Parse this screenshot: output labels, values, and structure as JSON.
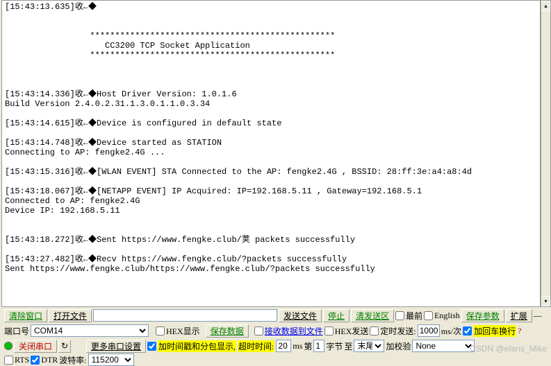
{
  "terminal": {
    "lines": [
      "[15:43:13.635]收←◆",
      "",
      "",
      "                 *************************************************",
      "                    CC3200 TCP Socket Application       ",
      "                 *************************************************",
      "",
      "",
      "",
      "[15:43:14.336]收←◆Host Driver Version: 1.0.1.6",
      "Build Version 2.4.0.2.31.1.3.0.1.1.0.3.34",
      "",
      "[15:43:14.615]收←◆Device is configured in default state ",
      "",
      "[15:43:14.748]收←◆Device started as STATION ",
      "Connecting to AP: fengke2.4G ...",
      "",
      "[15:43:15.316]收←◆[WLAN EVENT] STA Connected to the AP: fengke2.4G , BSSID: 28:ff:3e:a4:a8:4d",
      "",
      "[15:43:18.067]收←◆[NETAPP EVENT] IP Acquired: IP=192.168.5.11 , Gateway=192.168.5.1",
      "Connected to AP: fengke2.4G ",
      "Device IP: 192.168.5.11",
      "",
      "",
      "[15:43:18.272]收←◆Sent https://www.fengke.club/荚 packets successfully",
      "",
      "[15:43:27.482]收←◆Recv https://www.fengke.club/?packets successfully",
      "Sent https://www.fengke.club/https://www.fengke.club/?packets successfully"
    ]
  },
  "row1": {
    "clear_window": "清除窗口",
    "open_file": "打开文件",
    "send_file": "发送文件",
    "stop": "停止",
    "clear_send": "清发送区",
    "front": "最前",
    "english": "English",
    "save_params": "保存参数",
    "extend": "扩展",
    "dash_label": "—"
  },
  "row2": {
    "port_label": "端口号",
    "port_value": "COM14",
    "hex_display": "HEX显示",
    "save_data": "保存数据",
    "recv_to_file": "接收数据到文件",
    "hex_send": "HEX发送",
    "timed_send": "定时发送:",
    "interval_value": "1000",
    "interval_unit": "ms/次",
    "add_cr": "加回车换行",
    "question": "?"
  },
  "row3": {
    "led_status": "green",
    "close_port": "关闭串口",
    "more_settings": "更多串口设置",
    "timestamp_label": "加时间戳和分包显示,",
    "timeout_label": "超时时间:",
    "timeout_value": "20",
    "ms": "ms",
    "page_label": "第",
    "page_value": "1",
    "byte_label": "字节",
    "to_label": "至",
    "end_value": "末尾",
    "add_check": "加校验",
    "check_value": "None",
    "rts": "RTS",
    "dtr": "DTR",
    "baud_label": "波特率:",
    "baud_value": "115200"
  },
  "watermark": "CSDN @efans_Mike"
}
